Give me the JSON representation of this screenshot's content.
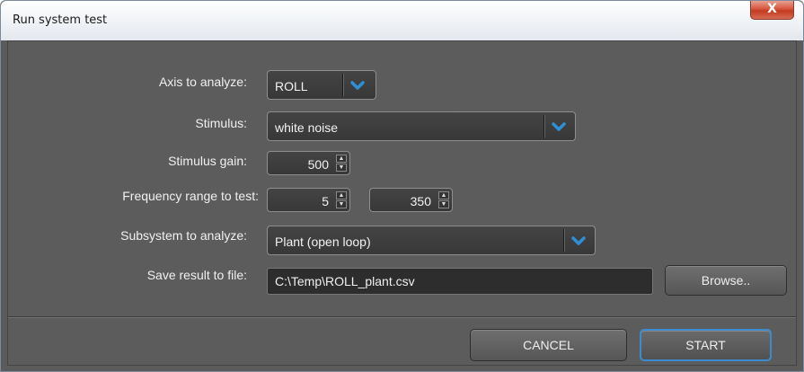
{
  "window": {
    "title": "Run system test",
    "close_label": "X"
  },
  "form": {
    "axis": {
      "label": "Axis to analyze:",
      "value": "ROLL"
    },
    "stimulus": {
      "label": "Stimulus:",
      "value": "white noise"
    },
    "stimulus_gain": {
      "label": "Stimulus gain:",
      "value": "500"
    },
    "frequency_range": {
      "label": "Frequency range to test:",
      "min": "5",
      "max": "350"
    },
    "subsystem": {
      "label": "Subsystem to analyze:",
      "value": "Plant (open loop)"
    },
    "save_file": {
      "label": "Save result to file:",
      "value": "C:\\Temp\\ROLL_plant.csv",
      "browse_label": "Browse.."
    }
  },
  "footer": {
    "cancel_label": "CANCEL",
    "start_label": "START"
  },
  "colors": {
    "accent": "#2f8fd6",
    "background": "#5c5c5c",
    "field": "#3c3c3c"
  },
  "icons": {
    "dropdown": "chevron-down-icon",
    "spinner": "spinner-arrows-icon",
    "close": "close-icon"
  }
}
